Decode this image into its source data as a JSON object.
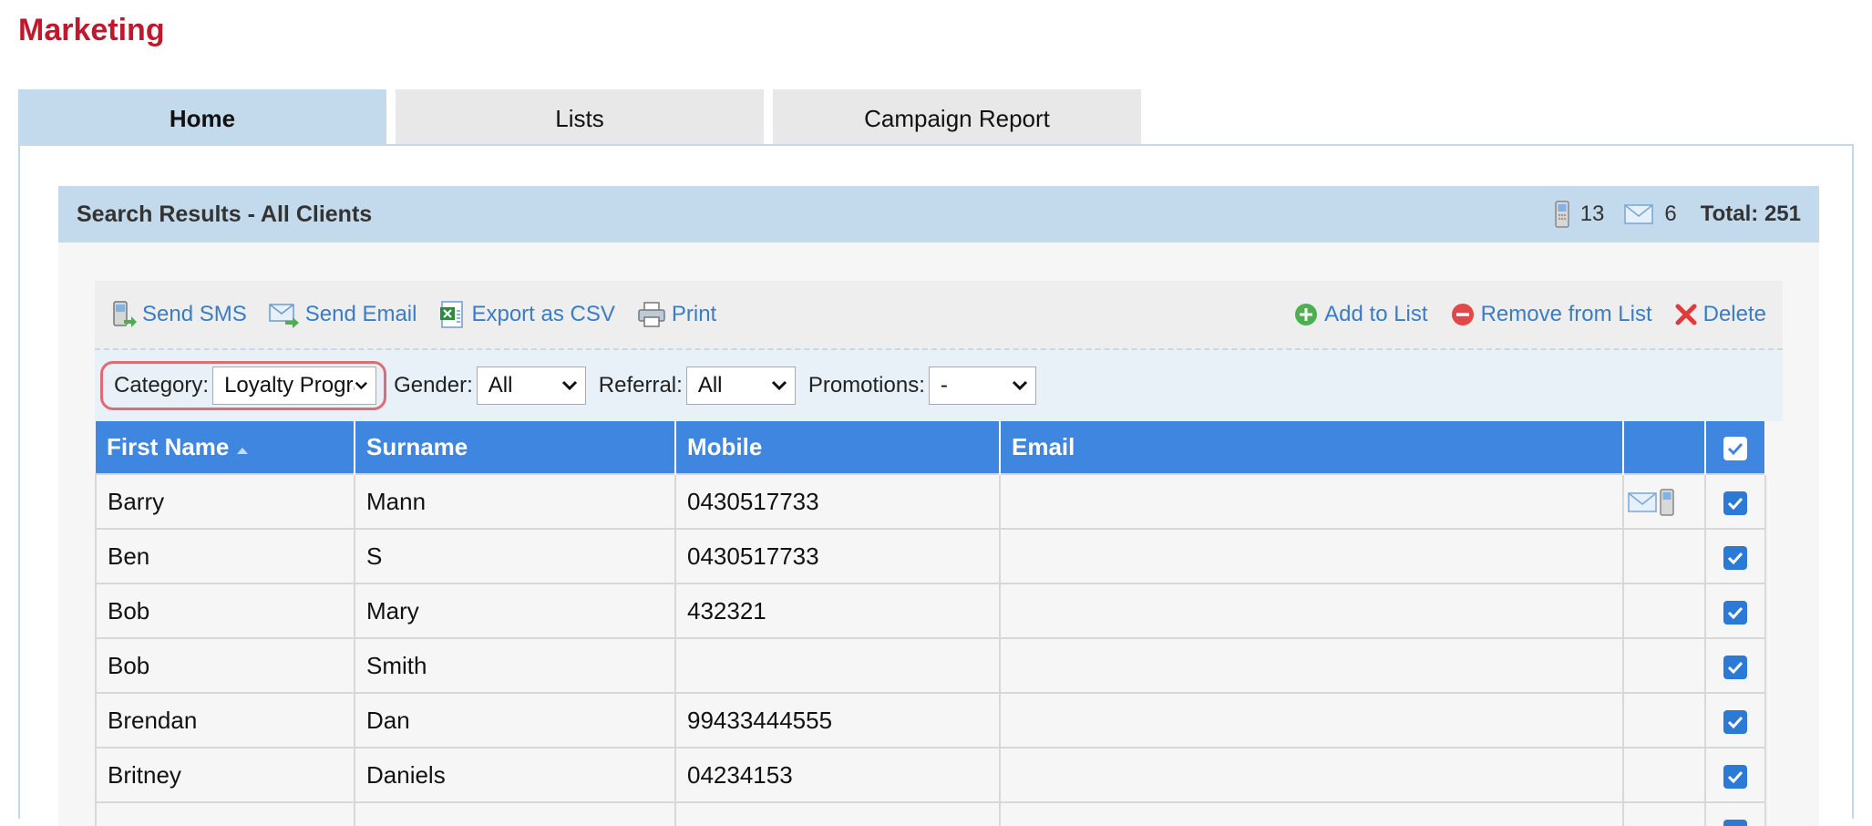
{
  "page": {
    "title": "Marketing"
  },
  "tabs": [
    {
      "label": "Home",
      "active": true
    },
    {
      "label": "Lists",
      "active": false
    },
    {
      "label": "Campaign Report",
      "active": false
    }
  ],
  "results": {
    "title": "Search Results - All Clients",
    "mobile_count": "13",
    "email_count": "6",
    "total_label": "Total: 251"
  },
  "toolbar": {
    "left": [
      {
        "label": "Send SMS",
        "icon": "send-sms-icon"
      },
      {
        "label": "Send Email",
        "icon": "send-email-icon"
      },
      {
        "label": "Export as CSV",
        "icon": "export-csv-icon"
      },
      {
        "label": "Print",
        "icon": "printer-icon"
      }
    ],
    "right": [
      {
        "label": "Add to List",
        "icon": "add-circle-icon"
      },
      {
        "label": "Remove from List",
        "icon": "remove-circle-icon"
      },
      {
        "label": "Delete",
        "icon": "delete-x-icon"
      }
    ]
  },
  "filters": {
    "category": {
      "label": "Category:",
      "value": "Loyalty Program"
    },
    "gender": {
      "label": "Gender:",
      "value": "All"
    },
    "referral": {
      "label": "Referral:",
      "value": "All"
    },
    "promotions": {
      "label": "Promotions:",
      "value": "-"
    }
  },
  "table": {
    "columns": [
      "First Name",
      "Surname",
      "Mobile",
      "Email"
    ],
    "rows": [
      {
        "first": "Barry",
        "surname": "Mann",
        "mobile": "0430517733",
        "email": "",
        "contact_icons": true,
        "checked": true
      },
      {
        "first": "Ben",
        "surname": "S",
        "mobile": "0430517733",
        "email": "",
        "contact_icons": false,
        "checked": true
      },
      {
        "first": "Bob",
        "surname": "Mary",
        "mobile": "432321",
        "email": "",
        "contact_icons": false,
        "checked": true
      },
      {
        "first": "Bob",
        "surname": "Smith",
        "mobile": "",
        "email": "",
        "contact_icons": false,
        "checked": true
      },
      {
        "first": "Brendan",
        "surname": "Dan",
        "mobile": "99433444555",
        "email": "",
        "contact_icons": false,
        "checked": true
      },
      {
        "first": "Britney",
        "surname": "Daniels",
        "mobile": "04234153",
        "email": "",
        "contact_icons": false,
        "checked": true
      },
      {
        "first": "",
        "surname": "",
        "mobile": "",
        "email": "",
        "contact_icons": false,
        "checked": true
      }
    ]
  },
  "colors": {
    "title_red": "#c0182c",
    "tab_active": "#c3d9ec",
    "table_header": "#3e86e0",
    "link_blue": "#3a7cc6"
  }
}
